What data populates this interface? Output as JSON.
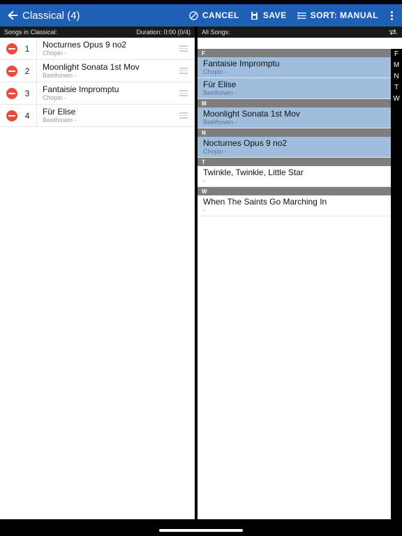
{
  "toolbar": {
    "title": "Classical (4)",
    "cancel": "CANCEL",
    "save": "SAVE",
    "sort": "SORT: MANUAL"
  },
  "left": {
    "header_label": "Songs in Classical:",
    "duration": "Duration: 0:00 (0/4)",
    "songs": [
      {
        "n": "1",
        "title": "Nocturnes Opus 9 no2",
        "artist": "Chopin -"
      },
      {
        "n": "2",
        "title": "Moonlight Sonata 1st Mov",
        "artist": "Beethoven -"
      },
      {
        "n": "3",
        "title": "Fantaisie Impromptu",
        "artist": "Chopin -"
      },
      {
        "n": "4",
        "title": "Für Elise",
        "artist": "Beethoven -"
      }
    ]
  },
  "right": {
    "header_label": "All Songs:",
    "sections": [
      {
        "letter": "F",
        "songs": [
          {
            "title": "Fantaisie Impromptu",
            "artist": "Chopin -",
            "selected": true
          },
          {
            "title": "Für Elise",
            "artist": "Beethoven -",
            "selected": true
          }
        ]
      },
      {
        "letter": "M",
        "songs": [
          {
            "title": "Moonlight Sonata 1st Mov",
            "artist": "Beethoven -",
            "selected": true
          }
        ]
      },
      {
        "letter": "N",
        "songs": [
          {
            "title": "Nocturnes Opus 9 no2",
            "artist": "Chopin -",
            "selected": true
          }
        ]
      },
      {
        "letter": "T",
        "songs": [
          {
            "title": "Twinkle, Twinkle, Little Star",
            "artist": "-",
            "selected": false
          }
        ]
      },
      {
        "letter": "W",
        "songs": [
          {
            "title": "When The Saints Go Marching In",
            "artist": "-",
            "selected": false
          }
        ]
      }
    ],
    "index": [
      "F",
      "M",
      "N",
      "T",
      "W"
    ]
  }
}
